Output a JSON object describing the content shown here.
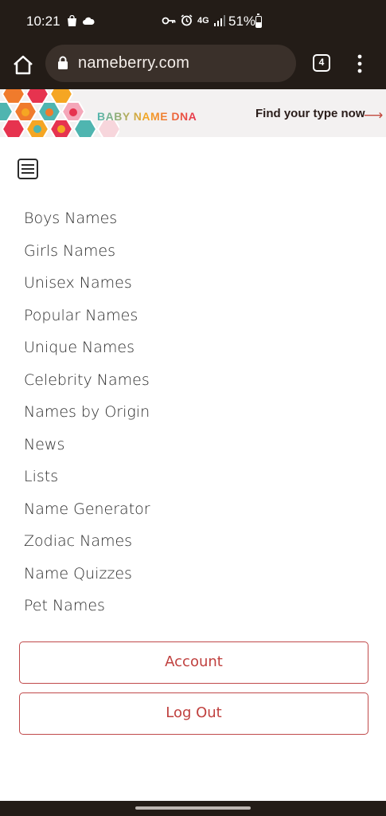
{
  "status_bar": {
    "time": "10:21",
    "network": "4G",
    "battery": "51%"
  },
  "browser": {
    "url": "nameberry.com",
    "tab_count": "4"
  },
  "banner": {
    "brand_text": "BABY NAME DNA",
    "cta": "Find your type now",
    "arrow": "⟶"
  },
  "nav": {
    "items": [
      "Boys Names",
      "Girls Names",
      "Unisex Names",
      "Popular Names",
      "Unique Names",
      "Celebrity Names",
      "Names by Origin",
      "News",
      "Lists",
      "Name Generator",
      "Zodiac Names",
      "Name Quizzes",
      "Pet Names"
    ]
  },
  "buttons": {
    "account": "Account",
    "logout": "Log Out"
  },
  "colors": {
    "accent": "#c0413f",
    "chrome": "#231c17"
  }
}
